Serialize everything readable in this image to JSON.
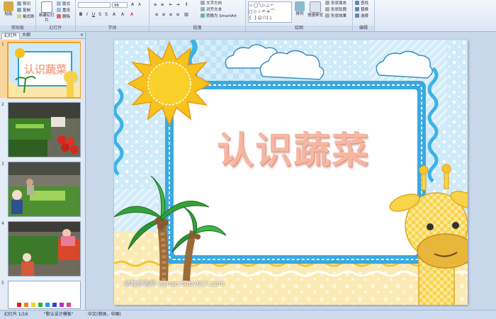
{
  "ribbon": {
    "groups": {
      "clipboard": "剪贴板",
      "slides": "幻灯片",
      "font": "字体",
      "paragraph": "段落",
      "drawing": "绘图",
      "editing": "编辑"
    },
    "paste": "粘贴",
    "cut": "剪切",
    "copy": "复制",
    "format_painter": "格式刷",
    "new_slide": "新建幻灯片",
    "layout": "版式",
    "reset": "重设",
    "delete": "删除",
    "font_size": "96",
    "text_direction": "文字方向",
    "align_text": "对齐文本",
    "convert_smartart": "转换为 SmartArt",
    "arrange": "排列",
    "quick_styles": "快速样式",
    "shape_fill": "形状填充",
    "shape_outline": "形状轮廓",
    "shape_effects": "形状效果",
    "find": "查找",
    "replace": "替换",
    "select": "选择"
  },
  "pane": {
    "tab_slides": "幻灯片",
    "tab_outline": "大纲",
    "thumbs": [
      {
        "num": "1"
      },
      {
        "num": "2"
      },
      {
        "num": "3"
      },
      {
        "num": "4"
      },
      {
        "num": "5"
      }
    ]
  },
  "slide": {
    "title": "认识蔬菜",
    "watermark": "幼教资源网 ziyuan.baby611.com"
  },
  "status": {
    "slide_index": "幻灯片 1/16",
    "theme": "\"默认设计模板\"",
    "language": "中文(简体，中国)"
  },
  "colors": {
    "ribbon_bg": "#dbe6f4",
    "slide_bg": "#cfeaf8",
    "title_fill": "#f6b7a2",
    "selected_thumb": "#f0a030"
  }
}
